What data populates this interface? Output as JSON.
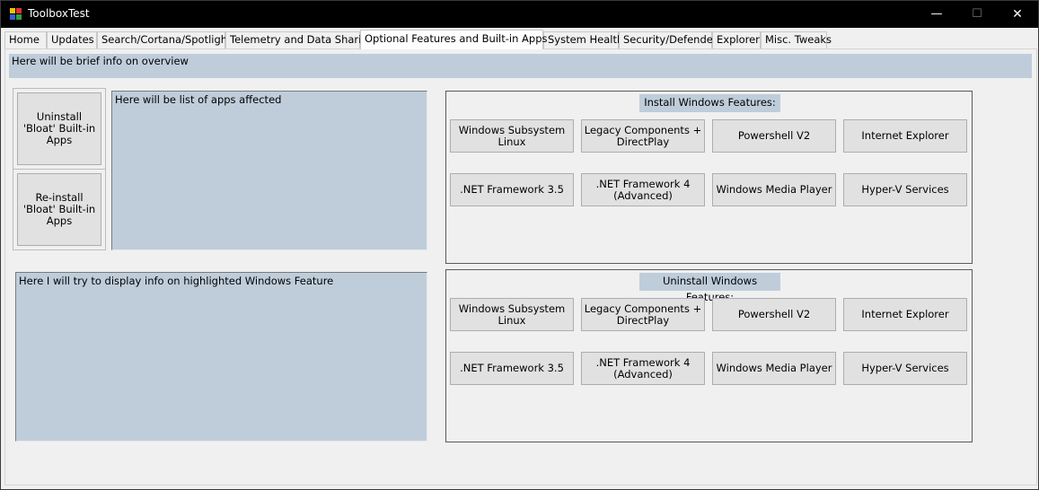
{
  "window": {
    "title": "ToolboxTest",
    "controls": {
      "minimize": "—",
      "maximize": "☐",
      "close": "✕"
    }
  },
  "tabs": [
    "Home",
    "Updates",
    "Search/Cortana/Spotlight",
    "Telemetry and Data Sharing",
    "Optional Features and Built-in Apps",
    "System Health",
    "Security/Defender",
    "Explorer",
    "Misc. Tweaks"
  ],
  "active_tab": "Optional Features and Built-in Apps",
  "overview_text": "Here will be brief info on overview",
  "apps": {
    "uninstall_button": "Uninstall 'Bloat' Built-in Apps",
    "reinstall_button": "Re-install 'Bloat' Built-in Apps",
    "list_text": "Here will be list of apps affected"
  },
  "feature_info_text": "Here I will try to display info on highlighted Windows Feature",
  "install_group": {
    "title": "Install Windows Features:",
    "buttons": [
      "Windows Subsystem Linux",
      "Legacy Components + DirectPlay",
      "Powershell V2",
      "Internet Explorer",
      ".NET Framework 3.5",
      ".NET Framework 4 (Advanced)",
      "Windows Media Player",
      "Hyper-V Services"
    ]
  },
  "uninstall_group": {
    "title": "Uninstall Windows Features:",
    "buttons": [
      "Windows Subsystem Linux",
      "Legacy Components + DirectPlay",
      "Powershell V2",
      "Internet Explorer",
      ".NET Framework 3.5",
      ".NET Framework 4 (Advanced)",
      "Windows Media Player",
      "Hyper-V Services"
    ]
  },
  "colors": {
    "titlebar": "#000000",
    "panel_fill": "#bfcddb",
    "button_face": "#e1e1e1",
    "window_bg": "#f0f0f0"
  }
}
